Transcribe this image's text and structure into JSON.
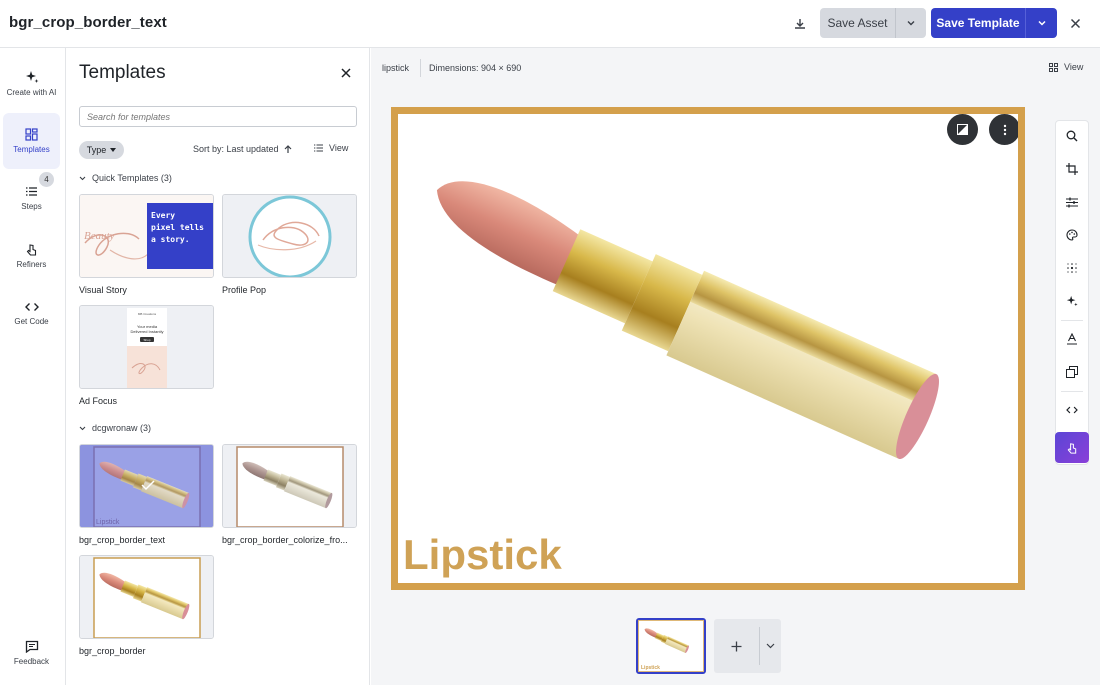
{
  "header": {
    "asset_title": "bgr_crop_border_text",
    "save_asset_label": "Save Asset",
    "save_template_label": "Save Template",
    "icons": [
      "download-icon",
      "chevron-down-icon",
      "close-icon"
    ]
  },
  "rail": {
    "items": [
      {
        "label": "Create with AI",
        "icon": "sparkle-icon"
      },
      {
        "label": "Templates",
        "icon": "grid-icon",
        "active": true
      },
      {
        "label": "Steps",
        "icon": "list-icon",
        "badge": "4"
      },
      {
        "label": "Refiners",
        "icon": "pointer-icon"
      },
      {
        "label": "Get Code",
        "icon": "code-icon"
      }
    ],
    "feedback_label": "Feedback"
  },
  "templates": {
    "title": "Templates",
    "search_placeholder": "Search for templates",
    "type_filter_label": "Type",
    "sort_label": "Sort by: Last updated",
    "view_label": "View",
    "groups": [
      {
        "label": "Quick Templates (3)",
        "items": [
          {
            "name": "Visual Story",
            "overlay_text": "Every pixel tells a story.",
            "handwriting": "Beauty"
          },
          {
            "name": "Profile Pop"
          },
          {
            "name": "Ad Focus",
            "mini_header": "MB Creations",
            "mini_headline": "Your media Delivered Instantly",
            "mini_button": "Shop"
          }
        ]
      },
      {
        "label": "dcgwronaw (3)",
        "items": [
          {
            "name": "bgr_crop_border_text",
            "selected": true,
            "caption": "Lipstick"
          },
          {
            "name": "bgr_crop_border_colorize_fro..."
          },
          {
            "name": "bgr_crop_border"
          }
        ]
      }
    ]
  },
  "canvas": {
    "asset_name": "lipstick",
    "dimensions": "Dimensions: 904 × 690",
    "view_label": "View",
    "caption": "Lipstick",
    "border_color": "#d4a04c",
    "thumb_caption": "Lipstick"
  },
  "tools": [
    "search-icon",
    "crop-icon",
    "adjust-icon",
    "palette-icon",
    "blur-icon",
    "sparkle-icon",
    "text-icon",
    "layers-icon",
    "code-icon",
    "refiners-icon"
  ],
  "colors": {
    "accent": "#3440c8",
    "gold": "#d4a04c"
  }
}
